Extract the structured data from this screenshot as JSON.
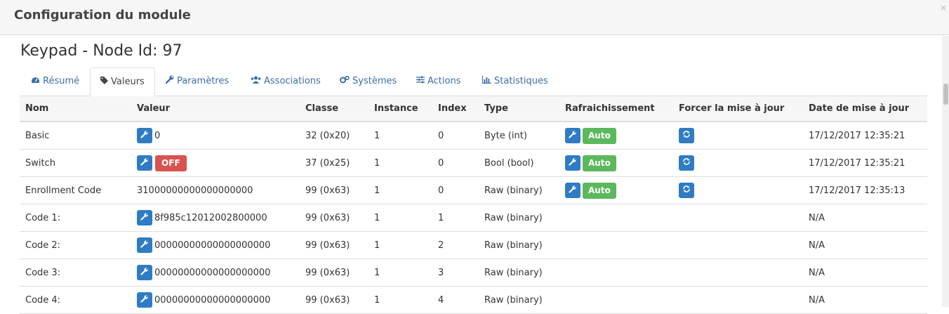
{
  "modal": {
    "title": "Configuration du module",
    "close": "×"
  },
  "node_title": "Keypad - Node Id: 97",
  "tabs": [
    {
      "label": "Résumé",
      "icon": "dashboard-icon",
      "active": false
    },
    {
      "label": "Valeurs",
      "icon": "tag-icon",
      "active": true
    },
    {
      "label": "Paramètres",
      "icon": "wrench-icon",
      "active": false
    },
    {
      "label": "Associations",
      "icon": "users-icon",
      "active": false
    },
    {
      "label": "Systèmes",
      "icon": "cogs-icon",
      "active": false
    },
    {
      "label": "Actions",
      "icon": "sliders-icon",
      "active": false
    },
    {
      "label": "Statistiques",
      "icon": "bar-chart-icon",
      "active": false
    }
  ],
  "table": {
    "headers": [
      "Nom",
      "Valeur",
      "Classe",
      "Instance",
      "Index",
      "Type",
      "Rafraichissement",
      "Forcer la mise à jour",
      "Date de mise à jour"
    ],
    "auto_label": "Auto",
    "off_label": "OFF",
    "rows": [
      {
        "name": "Basic",
        "value": "0",
        "classe": "32 (0x20)",
        "instance": "1",
        "index": "0",
        "type": "Byte (int)",
        "date": "17/12/2017 12:35:21"
      },
      {
        "name": "Switch",
        "value": "",
        "classe": "37 (0x25)",
        "instance": "1",
        "index": "0",
        "type": "Bool (bool)",
        "date": "17/12/2017 12:35:21"
      },
      {
        "name": "Enrollment Code",
        "value": "31000000000000000000",
        "classe": "99 (0x63)",
        "instance": "1",
        "index": "0",
        "type": "Raw (binary)",
        "date": "17/12/2017 12:35:13"
      },
      {
        "name": "Code 1:",
        "value": "8f985c12012002800000",
        "classe": "99 (0x63)",
        "instance": "1",
        "index": "1",
        "type": "Raw (binary)",
        "date": "N/A"
      },
      {
        "name": "Code 2:",
        "value": "00000000000000000000",
        "classe": "99 (0x63)",
        "instance": "1",
        "index": "2",
        "type": "Raw (binary)",
        "date": "N/A"
      },
      {
        "name": "Code 3:",
        "value": "00000000000000000000",
        "classe": "99 (0x63)",
        "instance": "1",
        "index": "3",
        "type": "Raw (binary)",
        "date": "N/A"
      },
      {
        "name": "Code 4:",
        "value": "00000000000000000000",
        "classe": "99 (0x63)",
        "instance": "1",
        "index": "4",
        "type": "Raw (binary)",
        "date": "N/A"
      }
    ]
  },
  "colors": {
    "primary": "#2f7cc4",
    "success": "#5cb85c",
    "danger": "#d9534f",
    "link": "#3a6ea8"
  }
}
